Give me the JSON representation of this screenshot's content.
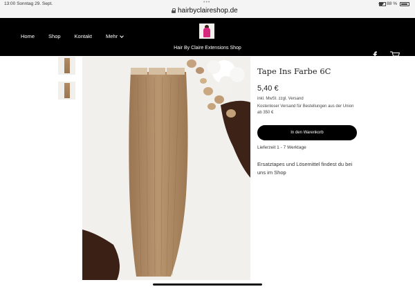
{
  "status_bar": {
    "time_date": "13:00  Sonntag 29. Sept.",
    "dots": "•••",
    "battery": "88 %"
  },
  "browser": {
    "url": "hairbyclaireshop.de"
  },
  "header": {
    "nav": [
      "Home",
      "Shop",
      "Kontakt",
      "Mehr"
    ],
    "site_title": "Hair By Claire Extensions Shop"
  },
  "product": {
    "title": "Tape Ins Farbe 6C",
    "price": "5,40 €",
    "tax_line": "inkl. MwSt. zzgl. Versand",
    "shipping_note": "Kostenloser Versand für Bestellungen aus der Union ab 350 €",
    "cart_button": "In den Warenkorb",
    "delivery": "Lieferzeit 1 - 7 Werktage",
    "info": "Ersatztapes und Lösemittel findest du bei uns im Shop"
  },
  "colors": {
    "header_bg": "#000000",
    "button_bg": "#000000",
    "hair": "#a8845f"
  },
  "icons": [
    "lock-icon",
    "tabs-icon",
    "wifi-icon",
    "battery-icon",
    "facebook-icon",
    "cart-icon",
    "chevron-down-icon"
  ]
}
